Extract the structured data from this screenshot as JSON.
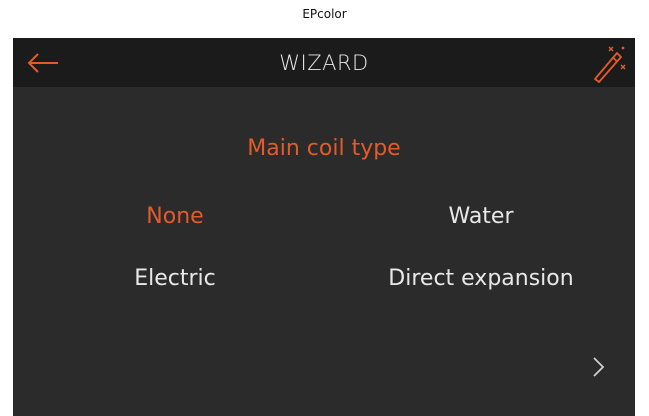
{
  "app": {
    "name": "EPcolor"
  },
  "header": {
    "title": "WIZARD",
    "back_icon": "arrow-left-icon",
    "wizard_icon": "magic-wand-icon"
  },
  "main": {
    "heading": "Main coil type",
    "options": [
      {
        "label": "None",
        "selected": true
      },
      {
        "label": "Water",
        "selected": false
      },
      {
        "label": "Electric",
        "selected": false
      },
      {
        "label": "Direct expansion",
        "selected": false
      }
    ],
    "next_icon": "chevron-right-icon"
  },
  "colors": {
    "accent": "#e55a2b",
    "background": "#2b2b2b",
    "header_background": "#1b1b1b",
    "text": "#e8e8e8"
  }
}
